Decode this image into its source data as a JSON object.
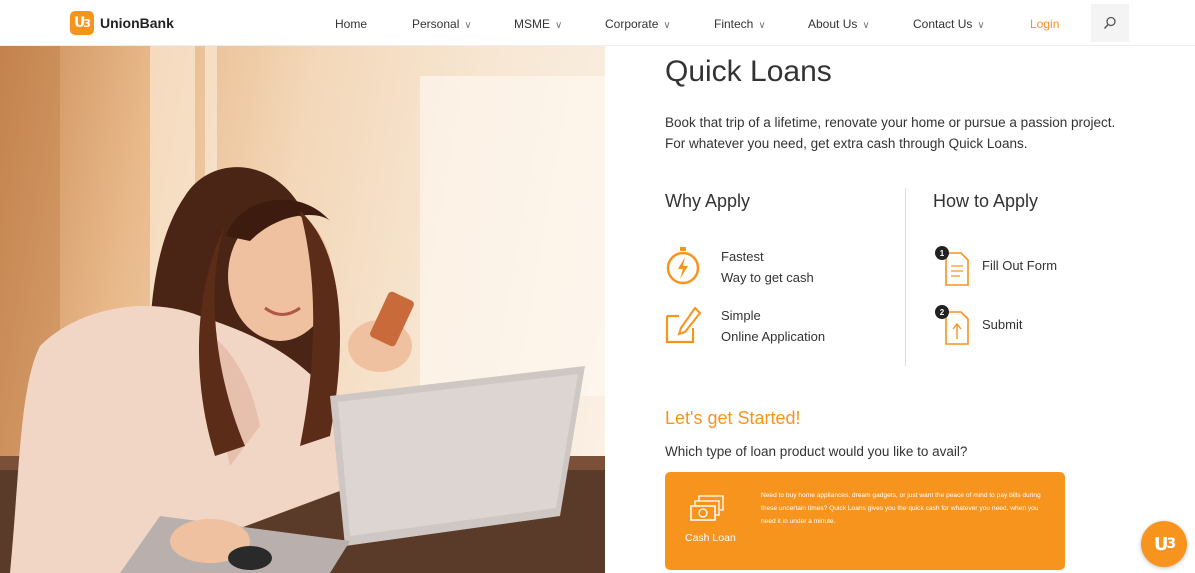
{
  "brand": {
    "mark": "U",
    "name": "UnionBank",
    "accent_color": "#f7941d"
  },
  "nav": {
    "home": "Home",
    "personal": "Personal",
    "msme": "MSME",
    "corporate": "Corporate",
    "fintech": "Fintech",
    "about": "About Us",
    "contact": "Contact Us",
    "login": "Login",
    "chevron": "∨",
    "search_icon": "search-icon"
  },
  "hero": {
    "image": "woman-with-phone-and-laptop"
  },
  "page": {
    "title": "Quick Loans",
    "intro": "Book that trip of a lifetime, renovate your home or pursue a passion project. For whatever you need, get extra cash through Quick Loans."
  },
  "why_apply": {
    "heading": "Why Apply",
    "items": [
      {
        "icon": "stopwatch-bolt-icon",
        "line1": "Fastest",
        "line2": "Way to get cash"
      },
      {
        "icon": "pencil-note-icon",
        "line1": "Simple",
        "line2": "Online Application"
      }
    ]
  },
  "how_to_apply": {
    "heading": "How to Apply",
    "steps": [
      {
        "number": "1",
        "icon": "document-icon",
        "label": "Fill Out Form"
      },
      {
        "number": "2",
        "icon": "upload-document-icon",
        "label": "Submit"
      }
    ]
  },
  "get_started": {
    "heading": "Let's get Started!",
    "question": "Which type of loan product would you like to avail?"
  },
  "loan_card": {
    "icon": "cash-stack-icon",
    "label": "Cash Loan",
    "description": "Need to buy home appliances, dream gadgets, or just want the peace of mind to pay bills during these uncertain times? Quick Loans gives you the quick cash for whatever you need, when you need it in under a minute."
  },
  "chat": {
    "mark": "U",
    "icon": "chat-assistant-icon"
  }
}
